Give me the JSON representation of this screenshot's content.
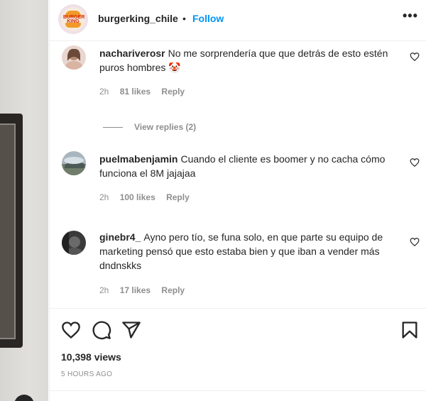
{
  "header": {
    "username": "burgerking_chile",
    "separator": "•",
    "follow_label": "Follow",
    "more_label": "•••",
    "logo_text": "BURGER KING"
  },
  "comments": [
    {
      "username": "nachariverosr",
      "text": "No me sorprendería que que detrás de esto estén puros hombres 🤡",
      "time": "2h",
      "likes": "81 likes",
      "reply": "Reply"
    },
    {
      "username": "puelmabenjamin",
      "text": "Cuando el cliente es boomer y no cacha cómo funciona el 8M jajajaa",
      "time": "2h",
      "likes": "100 likes",
      "reply": "Reply"
    },
    {
      "username": "ginebr4_",
      "text": "Ayno pero tío, se funa solo, en que parte su equipo de marketing pensó que esto estaba bien y que iban a vender más dndnskks",
      "time": "2h",
      "likes": "17 likes",
      "reply": "Reply"
    }
  ],
  "view_replies": "View replies (2)",
  "post": {
    "views": "10,398 views",
    "time_ago": "5 HOURS AGO"
  },
  "icons": [
    "heart-icon",
    "comment-icon",
    "share-icon",
    "bookmark-icon",
    "more-icon"
  ]
}
